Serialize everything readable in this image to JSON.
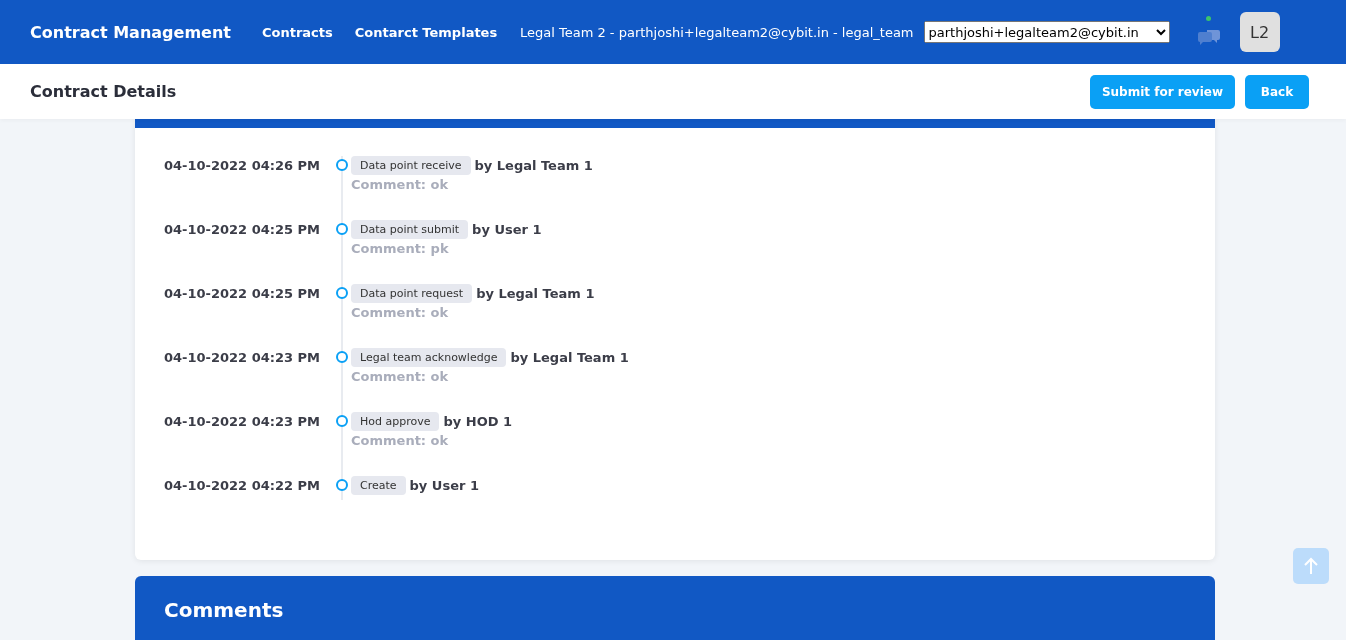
{
  "header": {
    "brand": "Contract Management",
    "nav": [
      {
        "label": "Contracts"
      },
      {
        "label": "Contarct Templates"
      }
    ],
    "user_info": "Legal Team 2 - parthjoshi+legalteam2@cybit.in - legal_team",
    "user_select": {
      "value": "parthjoshi+legalteam2@cybit.in"
    },
    "chat": {
      "online": true
    },
    "avatar": "L2"
  },
  "subheader": {
    "title": "Contract Details",
    "buttons": [
      "Submit for review",
      "Back"
    ]
  },
  "timeline": [
    {
      "date": "04-10-2022 04:26 PM",
      "action": "Data point receive",
      "by": "by Legal Team 1",
      "comment": "Comment: ok"
    },
    {
      "date": "04-10-2022 04:25 PM",
      "action": "Data point submit",
      "by": "by User 1",
      "comment": "Comment: pk"
    },
    {
      "date": "04-10-2022 04:25 PM",
      "action": "Data point request",
      "by": "by Legal Team 1",
      "comment": "Comment: ok"
    },
    {
      "date": "04-10-2022 04:23 PM",
      "action": "Legal team acknowledge",
      "by": "by Legal Team 1",
      "comment": "Comment: ok"
    },
    {
      "date": "04-10-2022 04:23 PM",
      "action": "Hod approve",
      "by": "by HOD 1",
      "comment": "Comment: ok"
    },
    {
      "date": "04-10-2022 04:22 PM",
      "action": "Create",
      "by": "by User 1"
    }
  ],
  "comments": {
    "title": "Comments"
  }
}
